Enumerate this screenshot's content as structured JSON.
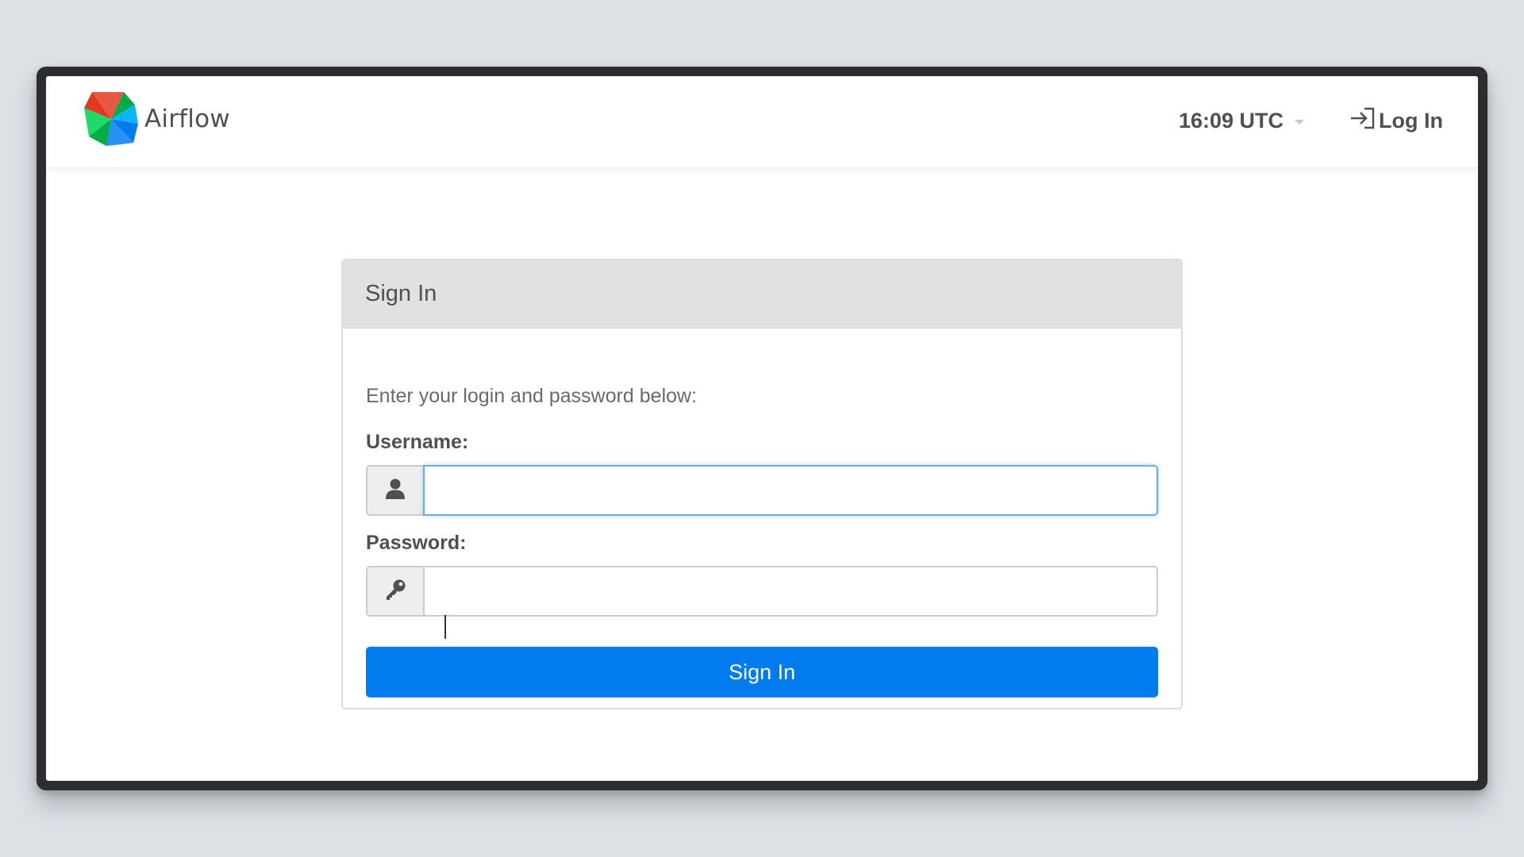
{
  "navbar": {
    "brand_name": "Airflow",
    "logo_icon": "airflow-pinwheel-logo",
    "clock_text": "16:09 UTC",
    "clock_caret_icon": "caret-down-icon",
    "login_label": "Log In",
    "login_icon": "sign-in-icon"
  },
  "login_panel": {
    "title": "Sign In",
    "intro_text": "Enter your login and password below:",
    "username_label": "Username:",
    "username_value": "",
    "username_icon": "user-icon",
    "password_label": "Password:",
    "password_value": "",
    "password_icon": "key-icon",
    "submit_label": "Sign In"
  },
  "colors": {
    "primary_button": "#017cee",
    "text": "#51504f",
    "panel_heading_bg": "#e1e1e1",
    "focus_ring": "#66afe9",
    "page_background": "#dde1e6"
  }
}
